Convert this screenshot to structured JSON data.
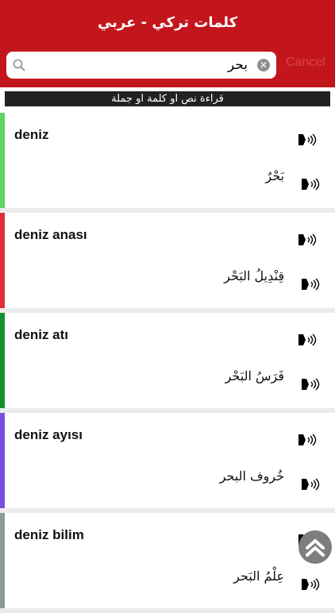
{
  "header": {
    "title": "كلمات تركي - عربي"
  },
  "search": {
    "value": "بحر",
    "cancel_label": "Cancel"
  },
  "read_bar": {
    "label": "قراءة  نص او كلمة او جملة"
  },
  "entries": [
    {
      "word": "deniz",
      "arabic": "بَحْرٌ",
      "color": "#5fd35f"
    },
    {
      "word": "deniz anası",
      "arabic": "قِنْدِيلُ البَحْر",
      "color": "#e02d37"
    },
    {
      "word": "deniz atı",
      "arabic": "فَرَسُ البَحْر",
      "color": "#12912f"
    },
    {
      "word": "deniz ayısı",
      "arabic": "خُروف البحر",
      "color": "#7a4ee0"
    },
    {
      "word": "deniz bilim",
      "arabic": "عِلْمُ البَحر",
      "color": "#8e9a98"
    }
  ],
  "colors": {
    "header": "#c3161c",
    "cancel": "#d94248"
  },
  "icons": {
    "search": "search-icon",
    "clear": "clear-icon",
    "speaker": "speaker-icon",
    "scroll_top": "chevron-up-icon"
  }
}
